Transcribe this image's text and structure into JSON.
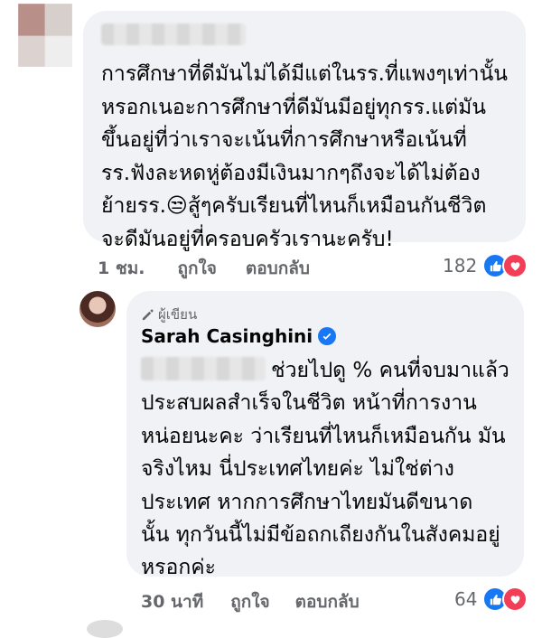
{
  "comment1": {
    "lines": [
      "การศึกษาที่ดีมันไม่ได้มีแต่ในรร.ที่แพงๆเท่านั้น",
      "หรอกเนอะการศึกษาที่ดีมันมีอยู่ทุกรร.แต่มัน",
      "ขึ้นอยู่ที่ว่าเราจะเน้นที่การศึกษาหรือเน้นที่",
      "รร.ฟังละหดหู่ต้องมีเงินมากๆถึงจะได้ไม่ต้อง",
      "ย้ายรร.😒สู้ๆครับเรียนที่ไหนก็เหมือนกันชีวิต",
      "จะดีมันอยู่ที่ครอบครัวเรานะครับ!"
    ],
    "time": "1 ชม.",
    "like_label": "ถูกใจ",
    "reply_label": "ตอบกลับ",
    "reaction_count": "182"
  },
  "comment2": {
    "author_badge": "ผู้เขียน",
    "author_name": "Sarah Casinghini",
    "first_line_rest": "ช่วยไปดู % คนที่จบมาแล้ว",
    "lines": [
      "ประสบผลสำเร็จในชีวิต หน้าที่การงาน",
      "หน่อยนะคะ ว่าเรียนที่ไหนก็เหมือนกัน มัน",
      "จริงไหม นี่ประเทศไทยค่ะ ไม่ใช่ต่าง",
      "ประเทศ หากการศึกษาไทยมันดีขนาด",
      "นั้น ทุกวันนี้ไม่มีข้อถกเถียงกันในสังคมอยู่",
      "หรอกค่ะ"
    ],
    "time": "30 นาที",
    "like_label": "ถูกใจ",
    "reply_label": "ตอบกลับ",
    "reaction_count": "64"
  },
  "colors": {
    "bubble": "#f0f2f5",
    "meta": "#65676b",
    "like": "#1877f2",
    "love": "#f33e58"
  },
  "icons": [
    "pencil-icon",
    "verified-badge-icon",
    "like-reaction-icon",
    "love-reaction-icon"
  ]
}
